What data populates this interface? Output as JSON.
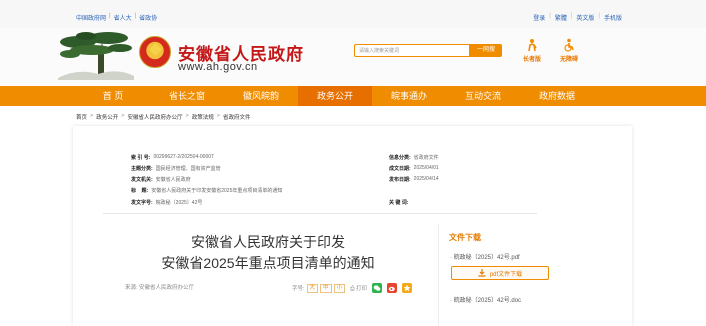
{
  "top_links": {
    "left": [
      "中国政府网",
      "省人大",
      "省政协"
    ],
    "separator": "|",
    "right": [
      "登录",
      "繁體",
      "英文版",
      "手机版"
    ]
  },
  "header": {
    "site_title": "安徽省人民政府",
    "site_url": "www.ah.gov.cn",
    "search_placeholder": "请输入搜索关键词",
    "search_button": "一网搜",
    "quick_links": [
      {
        "label": "长者版",
        "icon": "elder-icon"
      },
      {
        "label": "无障碍",
        "icon": "accessibility-icon"
      }
    ]
  },
  "nav": {
    "items": [
      "首 页",
      "省长之窗",
      "徽风皖韵",
      "政务公开",
      "皖事通办",
      "互动交流",
      "政府数据"
    ],
    "active_index": 3
  },
  "breadcrumb": [
    "首页",
    "政务公开",
    "安徽省人民政府办公厅",
    "政策法规",
    "省政府文件"
  ],
  "breadcrumb_separator": ">",
  "meta": {
    "index_no_label": "索 引 号:",
    "index_no": "00299627-2/202504-00007",
    "subject_label": "主题分类:",
    "subject": "国民经济管理、国有资产监管",
    "issuer_label": "发文机关:",
    "issuer": "安徽省人民政府",
    "title_label": "标    题:",
    "title": "安徽省人民政府关于印发安徽省2025年重点项目清单的通知",
    "doc_no_label": "发文字号:",
    "doc_no": "皖政秘〔2025〕42号",
    "source_label": "信息分类:",
    "source": "省政府文件",
    "created_label": "成文日期:",
    "created": "2025/04/01",
    "published_label": "发布日期:",
    "published": "2025/04/14",
    "keywords_label": "关 键 词:",
    "keywords": ""
  },
  "document": {
    "title_line1": "安徽省人民政府关于印发",
    "title_line2": "安徽省2025年重点项目清单的通知",
    "source_text": "来源: 安徽省人民政府办公厅",
    "font_size_label": "字号:",
    "font_sizes": [
      "大",
      "中",
      "小"
    ],
    "print_label": "打印"
  },
  "downloads": {
    "heading": "文件下载",
    "files": [
      "皖政秘〔2025〕42号.pdf",
      "皖政秘〔2025〕42号.doc"
    ],
    "pdf_button": "pdf文件下载"
  },
  "colors": {
    "brand_orange": "#f08c00",
    "title_red": "#c41818",
    "link_blue": "#2b64b8"
  }
}
